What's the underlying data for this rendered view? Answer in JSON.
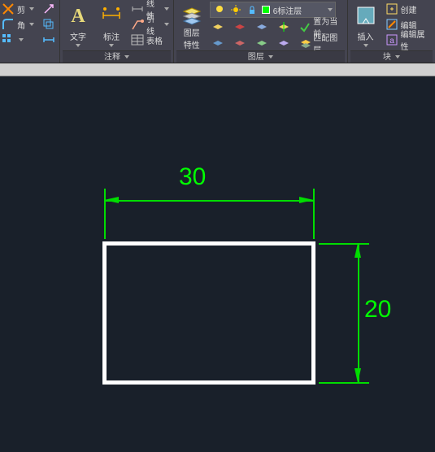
{
  "ribbon": {
    "groups": {
      "trim": {
        "trim_label": "剪",
        "corner_label": "角",
        "offset_label": ""
      },
      "annotation": {
        "label": "注释",
        "text_label": "文字",
        "dimension_label": "标注",
        "linear_label": "线性",
        "leader_label": "引线",
        "table_label": "表格"
      },
      "layers": {
        "label": "图层",
        "properties_label": "图层\n特性",
        "current_layer": "6标注层",
        "set_current_label": "置为当前",
        "match_label": "匹配图层"
      },
      "block": {
        "label": "块",
        "insert_label": "插入",
        "create_label": "创建",
        "edit_label": "编辑",
        "edit_attrs_label": "编辑属性"
      }
    }
  },
  "canvas": {
    "dim_horizontal": "30",
    "dim_vertical": "20"
  }
}
